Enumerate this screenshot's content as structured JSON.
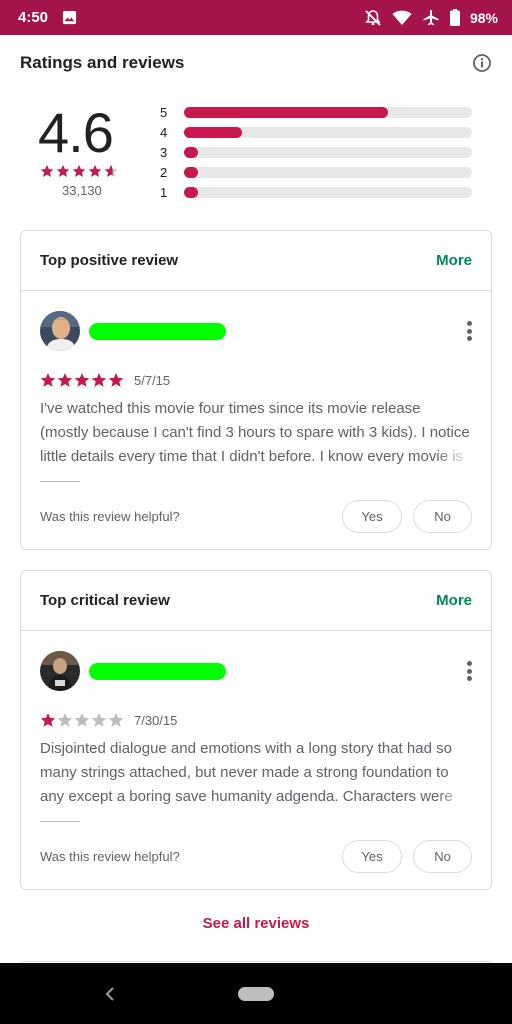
{
  "status_bar": {
    "time": "4:50",
    "battery": "98%"
  },
  "ratings": {
    "section_title": "Ratings and reviews",
    "average": "4.6",
    "average_stars": 4.6,
    "total_reviews": "33,130",
    "histogram": [
      {
        "label": "5",
        "fraction": 0.71
      },
      {
        "label": "4",
        "fraction": 0.2
      },
      {
        "label": "3",
        "fraction": 0.05
      },
      {
        "label": "2",
        "fraction": 0.04
      },
      {
        "label": "1",
        "fraction": 0.04
      }
    ]
  },
  "reviews": [
    {
      "card_title": "Top positive review",
      "more_label": "More",
      "stars": 5,
      "date": "5/7/15",
      "text": "I've watched this movie four times since its movie release (mostly because I can't find 3 hours to spare with 3 kids). I notice little details every time that I didn't before. I know every movie is",
      "helpful_label": "Was this review helpful?",
      "yes_label": "Yes",
      "no_label": "No"
    },
    {
      "card_title": "Top critical review",
      "more_label": "More",
      "stars": 1,
      "date": "7/30/15",
      "text": "Disjointed dialogue and emotions with a long story that had so many strings attached, but never made a strong foundation to any except a boring save humanity adgenda. Characters were",
      "helpful_label": "Was this review helpful?",
      "yes_label": "Yes",
      "no_label": "No"
    }
  ],
  "see_all_label": "See all reviews",
  "colors": {
    "accent": "#c8194f",
    "status_bar": "#a3154a",
    "more_link": "#01875f",
    "star_empty": "#bdbdbd"
  },
  "icons": [
    "photo-icon",
    "bell-off-icon",
    "wifi-icon",
    "airplane-icon",
    "battery-icon",
    "info-icon",
    "star-icon",
    "more-vert-icon",
    "back-icon"
  ]
}
